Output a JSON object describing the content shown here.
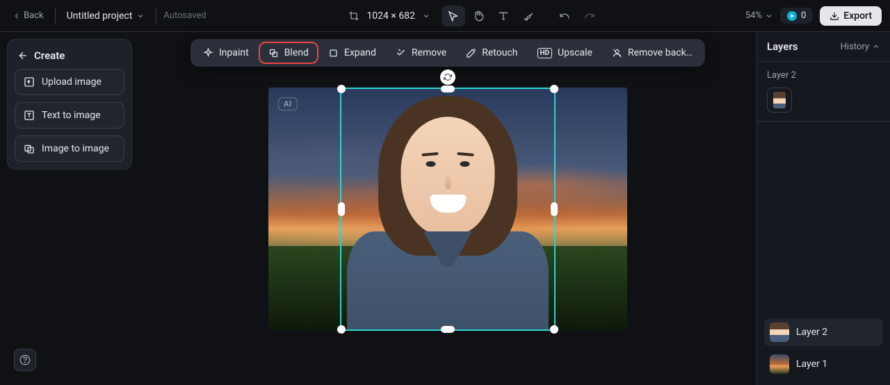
{
  "topbar": {
    "back": "Back",
    "project_name": "Untitled project",
    "autosaved": "Autosaved",
    "dimensions": "1024 × 682",
    "zoom": "54%",
    "credits": "0",
    "export": "Export"
  },
  "left_panel": {
    "create_label": "Create",
    "upload_image": "Upload image",
    "text_to_image": "Text to image",
    "image_to_image": "Image to image"
  },
  "context_toolbar": {
    "inpaint": "Inpaint",
    "blend": "Blend",
    "expand": "Expand",
    "remove": "Remove",
    "retouch": "Retouch",
    "upscale": "Upscale",
    "remove_bg": "Remove back…"
  },
  "canvas": {
    "ai_badge": "AI"
  },
  "right_panel": {
    "layers_title": "Layers",
    "history": "History",
    "current_layer": "Layer 2",
    "layers": [
      {
        "name": "Layer 2",
        "active": true
      },
      {
        "name": "Layer 1",
        "active": false
      }
    ]
  }
}
